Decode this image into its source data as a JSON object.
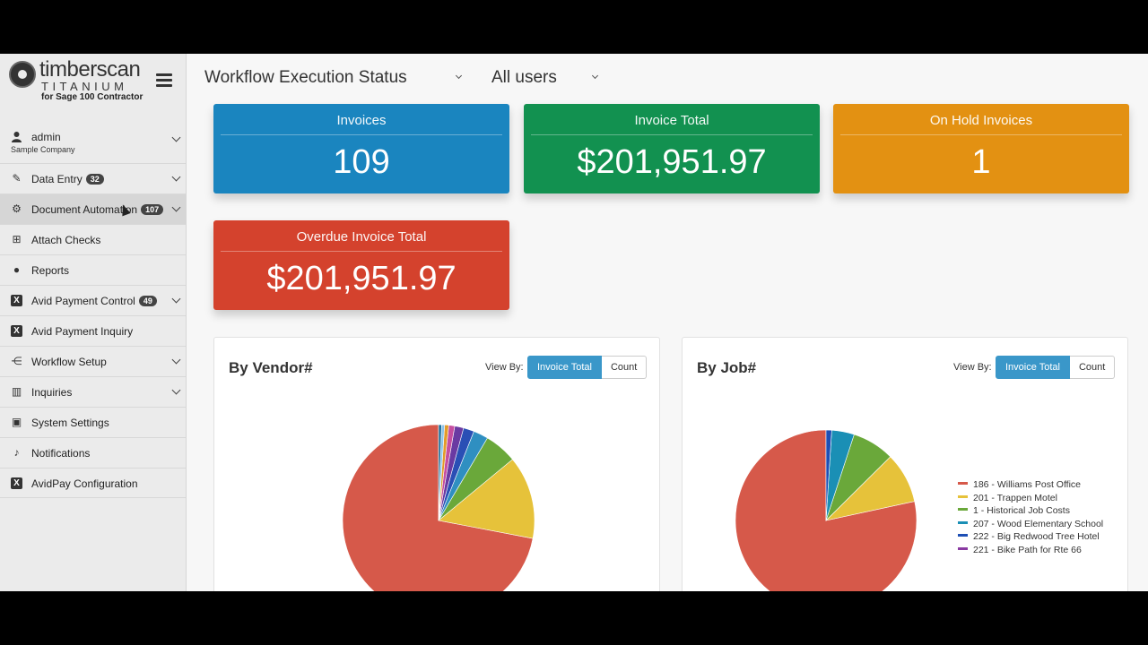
{
  "brand": {
    "name": "timberscan",
    "sub": "TITANIUM",
    "for": "for Sage 100 Contractor"
  },
  "user": {
    "name": "admin",
    "company": "Sample Company"
  },
  "nav": [
    {
      "label": "Data Entry",
      "badge": "32",
      "icon": "edit-icon"
    },
    {
      "label": "Document Automation",
      "badge": "107",
      "icon": "gear-icon"
    },
    {
      "label": "Attach Checks",
      "icon": "attach-checks-icon"
    },
    {
      "label": "Reports",
      "icon": "pie-chart-icon"
    },
    {
      "label": "Avid Payment Control",
      "badge": "49",
      "icon": "x-icon"
    },
    {
      "label": "Avid Payment Inquiry",
      "icon": "x-icon"
    },
    {
      "label": "Workflow Setup",
      "icon": "workflow-icon"
    },
    {
      "label": "Inquiries",
      "icon": "bar-chart-icon"
    },
    {
      "label": "System Settings",
      "icon": "settings-icon"
    },
    {
      "label": "Notifications",
      "icon": "bell-icon"
    },
    {
      "label": "AvidPay Configuration",
      "icon": "x-icon"
    }
  ],
  "filters": {
    "status": "Workflow Execution Status",
    "users": "All users"
  },
  "stats": {
    "invoices": {
      "title": "Invoices",
      "value": "109"
    },
    "invoice_total": {
      "title": "Invoice Total",
      "value": "$201,951.97"
    },
    "on_hold": {
      "title": "On Hold Invoices",
      "value": "1"
    },
    "overdue_total": {
      "title": "Overdue Invoice Total",
      "value": "$201,951.97"
    }
  },
  "colors": {
    "blue": "#1a85bf",
    "green": "#129150",
    "orange": "#e39112",
    "red": "#d4422d"
  },
  "panels": {
    "vendor": {
      "title": "By Vendor#",
      "view_by": "View By:",
      "btn_total": "Invoice Total",
      "btn_count": "Count"
    },
    "job": {
      "title": "By Job#",
      "view_by": "View By:",
      "btn_total": "Invoice Total",
      "btn_count": "Count"
    }
  },
  "chart_data": [
    {
      "type": "pie",
      "title": "By Vendor#",
      "values": [
        72,
        14,
        5.5,
        2.5,
        1.8,
        1.5,
        1.0,
        0.7,
        0.5,
        0.5
      ],
      "colors": [
        "#d6594a",
        "#e6c23a",
        "#6aa83a",
        "#2f8fc1",
        "#2a4fb5",
        "#6a3aa2",
        "#c54ea0",
        "#e39b2a",
        "#8cc2e8",
        "#1a6f9a"
      ]
    },
    {
      "type": "pie",
      "title": "By Job#",
      "values": [
        78,
        9,
        7.5,
        4,
        1
      ],
      "colors": [
        "#d6594a",
        "#e6c23a",
        "#6aa83a",
        "#1a8fb5",
        "#1e4fb5"
      ],
      "legend": [
        {
          "label": "186 - Williams Post Office",
          "color": "#d6594a"
        },
        {
          "label": "201 - Trappen Motel",
          "color": "#e6c23a"
        },
        {
          "label": "1 - Historical Job Costs",
          "color": "#6aa83a"
        },
        {
          "label": "207 - Wood Elementary School",
          "color": "#1a8fb5"
        },
        {
          "label": "222 - Big Redwood Tree Hotel",
          "color": "#1e4fb5"
        },
        {
          "label": "221 - Bike Path for Rte 66",
          "color": "#8a3aa2"
        }
      ]
    }
  ]
}
